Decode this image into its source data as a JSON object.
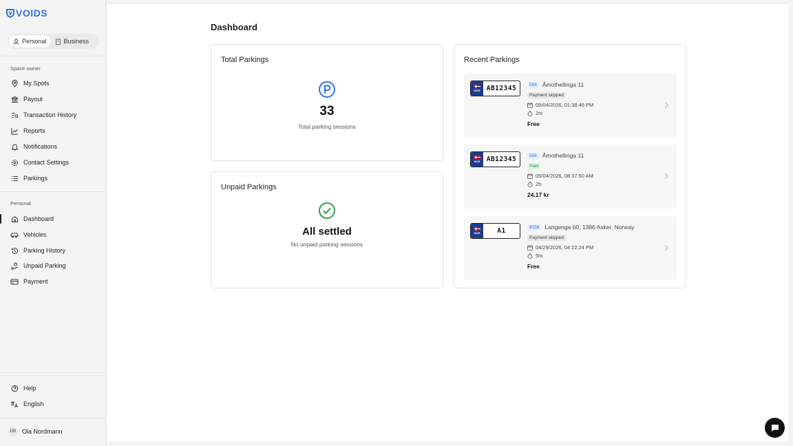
{
  "app": {
    "logo_text": "VOIDS"
  },
  "mode_toggle": {
    "personal": "Personal",
    "business": "Business"
  },
  "sidebar": {
    "space_owner_label": "Space owner",
    "space_owner_items": [
      {
        "label": "My Spots",
        "icon": "map-pin-icon"
      },
      {
        "label": "Payout",
        "icon": "bank-icon"
      },
      {
        "label": "Transaction History",
        "icon": "list-search-icon"
      },
      {
        "label": "Reports",
        "icon": "chart-line-icon"
      },
      {
        "label": "Notifications",
        "icon": "bell-icon"
      },
      {
        "label": "Contact Settings",
        "icon": "settings-icon"
      },
      {
        "label": "Parkings",
        "icon": "list-icon"
      }
    ],
    "personal_label": "Personal",
    "personal_items": [
      {
        "label": "Dashboard",
        "icon": "home-icon",
        "active": true
      },
      {
        "label": "Vehicles",
        "icon": "car-icon"
      },
      {
        "label": "Parking History",
        "icon": "history-icon"
      },
      {
        "label": "Unpaid Parking",
        "icon": "hand-coins-icon"
      },
      {
        "label": "Payment",
        "icon": "credit-card-icon"
      }
    ],
    "footer_items": [
      {
        "label": "Help",
        "icon": "help-circle-icon"
      },
      {
        "label": "English",
        "icon": "language-icon"
      }
    ],
    "user": {
      "initials": "DB",
      "name": "Ola Nordmann"
    }
  },
  "main": {
    "title": "Dashboard",
    "total_parkings": {
      "title": "Total Parkings",
      "count": "33",
      "caption": "Total parking sessions"
    },
    "unpaid_parkings": {
      "title": "Unpaid Parkings",
      "headline": "All settled",
      "caption": "No unpaid parking sessions"
    },
    "recent": {
      "title": "Recent Parkings",
      "items": [
        {
          "plate": "AB12345",
          "country": "NOR",
          "code": "556",
          "address": "Åmothellinga 11",
          "status": "Payment skipped",
          "status_type": "skipped",
          "datetime": "05/04/2026, 01:38:46 PM",
          "duration": "2m",
          "price": "Free"
        },
        {
          "plate": "AB12345",
          "country": "NOR",
          "code": "556",
          "address": "Åmothellinga 11",
          "status": "Paid",
          "status_type": "paid",
          "datetime": "05/04/2026, 08:37:50 AM",
          "duration": "2h",
          "price": "24.17 kr"
        },
        {
          "plate": "A1",
          "country": "NOR",
          "code": "6156",
          "address": "Langenga 60, 1386 Asker, Norway",
          "status": "Payment skipped",
          "status_type": "skipped",
          "datetime": "04/29/2026, 04:22:24 PM",
          "duration": "5m",
          "price": "Free"
        }
      ]
    }
  },
  "colors": {
    "brand": "#2f6fe4",
    "success": "#2d9e4a",
    "paid_text": "#2d8a3e"
  }
}
